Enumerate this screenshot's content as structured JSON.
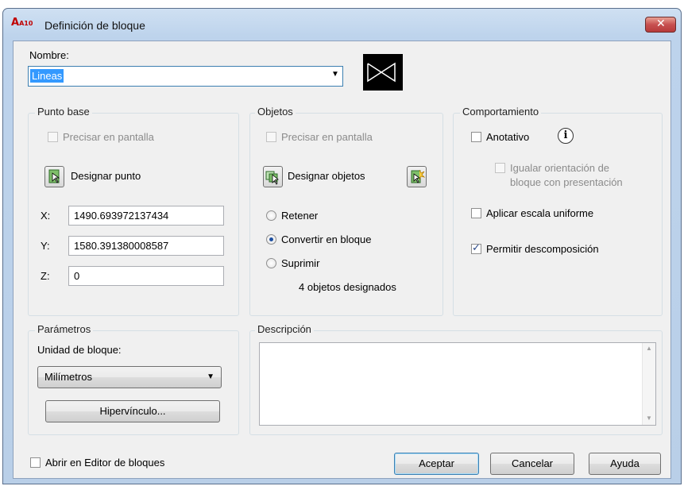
{
  "window": {
    "title": "Definición de bloque",
    "app_icon_text": "A10"
  },
  "nombre": {
    "label": "Nombre:",
    "value": "Lineas"
  },
  "punto_base": {
    "title": "Punto base",
    "precisar": "Precisar en pantalla",
    "designar": "Designar punto",
    "x_label": "X:",
    "x_value": "1490.693972137434",
    "y_label": "Y:",
    "y_value": "1580.391380008587",
    "z_label": "Z:",
    "z_value": "0"
  },
  "objetos": {
    "title": "Objetos",
    "precisar": "Precisar en pantalla",
    "designar": "Designar objetos",
    "retener": "Retener",
    "convertir": "Convertir en bloque",
    "suprimir": "Suprimir",
    "selected_option": "Convertir en bloque",
    "count_text": "4 objetos designados"
  },
  "comportamiento": {
    "title": "Comportamiento",
    "anotativo": "Anotativo",
    "igualar_line1": "Igualar orientación de",
    "igualar_line2": "bloque con presentación",
    "escala": "Aplicar escala uniforme",
    "permitir": "Permitir descomposición",
    "permitir_checked": true
  },
  "parametros": {
    "title": "Parámetros",
    "unidad_label": "Unidad de bloque:",
    "unidad_value": "Milímetros",
    "hipervinculo": "Hipervínculo..."
  },
  "descripcion": {
    "title": "Descripción",
    "value": ""
  },
  "footer": {
    "abrir_editor": "Abrir en Editor de bloques",
    "aceptar": "Aceptar",
    "cancelar": "Cancelar",
    "ayuda": "Ayuda"
  },
  "colors": {
    "close_button": "#c75050",
    "selection": "#3399ff"
  }
}
